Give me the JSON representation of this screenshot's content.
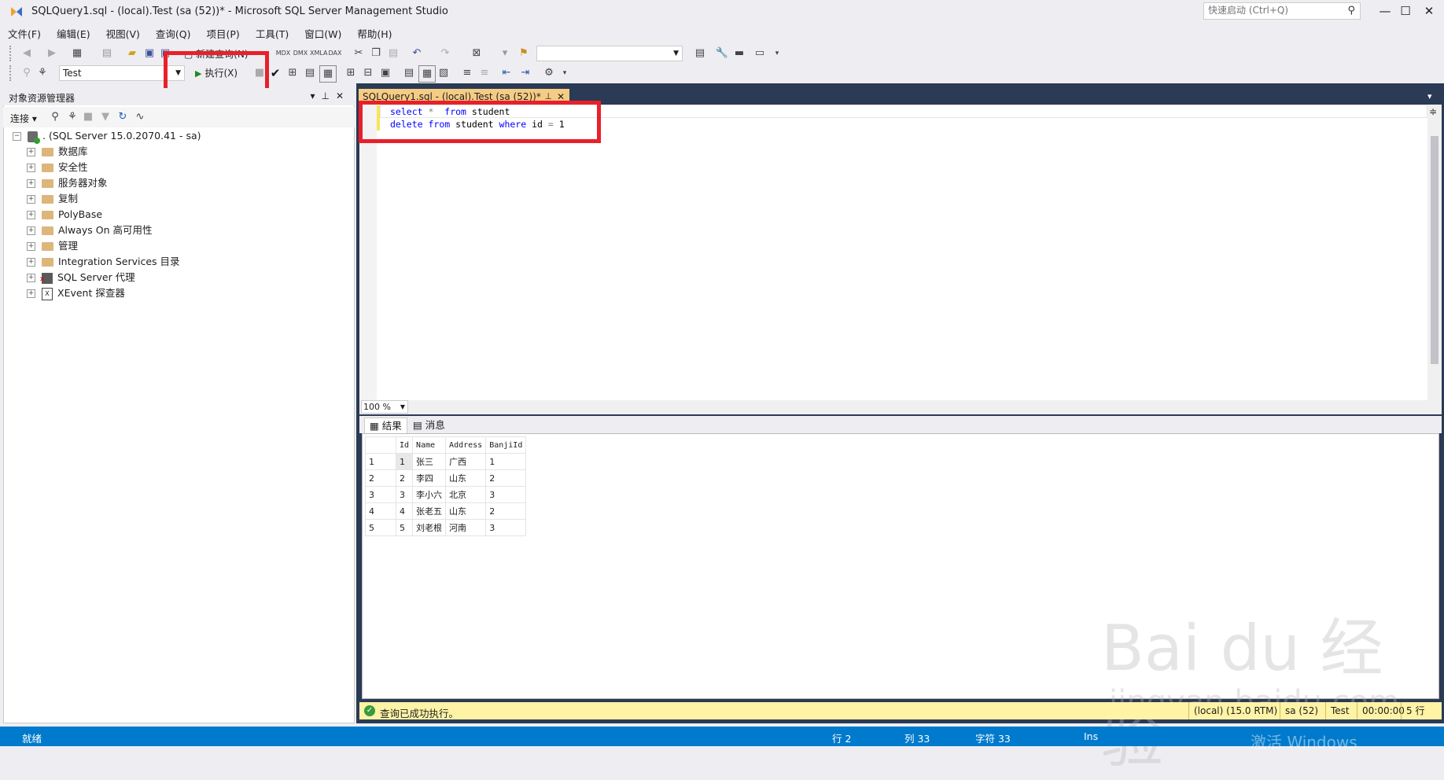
{
  "window": {
    "title": "SQLQuery1.sql - (local).Test (sa (52))* - Microsoft SQL Server Management Studio",
    "quick_launch_placeholder": "快速启动 (Ctrl+Q)",
    "minimize": "—",
    "maximize": "☐",
    "close": "✕"
  },
  "menu": [
    "文件(F)",
    "编辑(E)",
    "视图(V)",
    "查询(Q)",
    "项目(P)",
    "工具(T)",
    "窗口(W)",
    "帮助(H)"
  ],
  "toolbar": {
    "new_query": "新建查询(N)",
    "database_selector": "Test",
    "execute_label": "执行(X)"
  },
  "object_explorer": {
    "title": "对象资源管理器",
    "connect_label": "连接",
    "server_node": ". (SQL Server 15.0.2070.41 - sa)",
    "nodes": [
      {
        "label": "数据库",
        "icon": "folder-icon"
      },
      {
        "label": "安全性",
        "icon": "folder-icon"
      },
      {
        "label": "服务器对象",
        "icon": "folder-icon"
      },
      {
        "label": "复制",
        "icon": "folder-icon"
      },
      {
        "label": "PolyBase",
        "icon": "folder-icon"
      },
      {
        "label": "Always On 高可用性",
        "icon": "folder-icon"
      },
      {
        "label": "管理",
        "icon": "folder-icon"
      },
      {
        "label": "Integration Services 目录",
        "icon": "folder-icon"
      },
      {
        "label": "SQL Server 代理",
        "icon": "agent-icon"
      },
      {
        "label": "XEvent 探查器",
        "icon": "xevent-icon"
      }
    ]
  },
  "editor": {
    "tab_label": "SQLQuery1.sql - (local).Test (sa (52))*",
    "lines": [
      "select *  from student",
      "delete from student where id = 1"
    ],
    "zoom": "100 %"
  },
  "results": {
    "tabs": [
      "结果",
      "消息"
    ],
    "columns": [
      "Id",
      "Name",
      "Address",
      "BanjiId"
    ],
    "rows": [
      [
        "1",
        "1",
        "张三",
        "广西",
        "1"
      ],
      [
        "2",
        "2",
        "李四",
        "山东",
        "2"
      ],
      [
        "3",
        "3",
        "李小六",
        "北京",
        "3"
      ],
      [
        "4",
        "4",
        "张老五",
        "山东",
        "2"
      ],
      [
        "5",
        "5",
        "刘老根",
        "河南",
        "3"
      ]
    ]
  },
  "query_status": {
    "message": "查询已成功执行。",
    "server": "(local) (15.0 RTM)",
    "user": "sa (52)",
    "database": "Test",
    "elapsed": "00:00:00",
    "row_count": "5 行"
  },
  "status_bar": {
    "ready": "就绪",
    "line": "行 2",
    "col": "列 33",
    "char": "字符 33",
    "mode": "Ins",
    "activate": "激活 Windows"
  },
  "watermark": {
    "brand": "Bai du 经验",
    "url": "jingyan.baidu.com"
  }
}
